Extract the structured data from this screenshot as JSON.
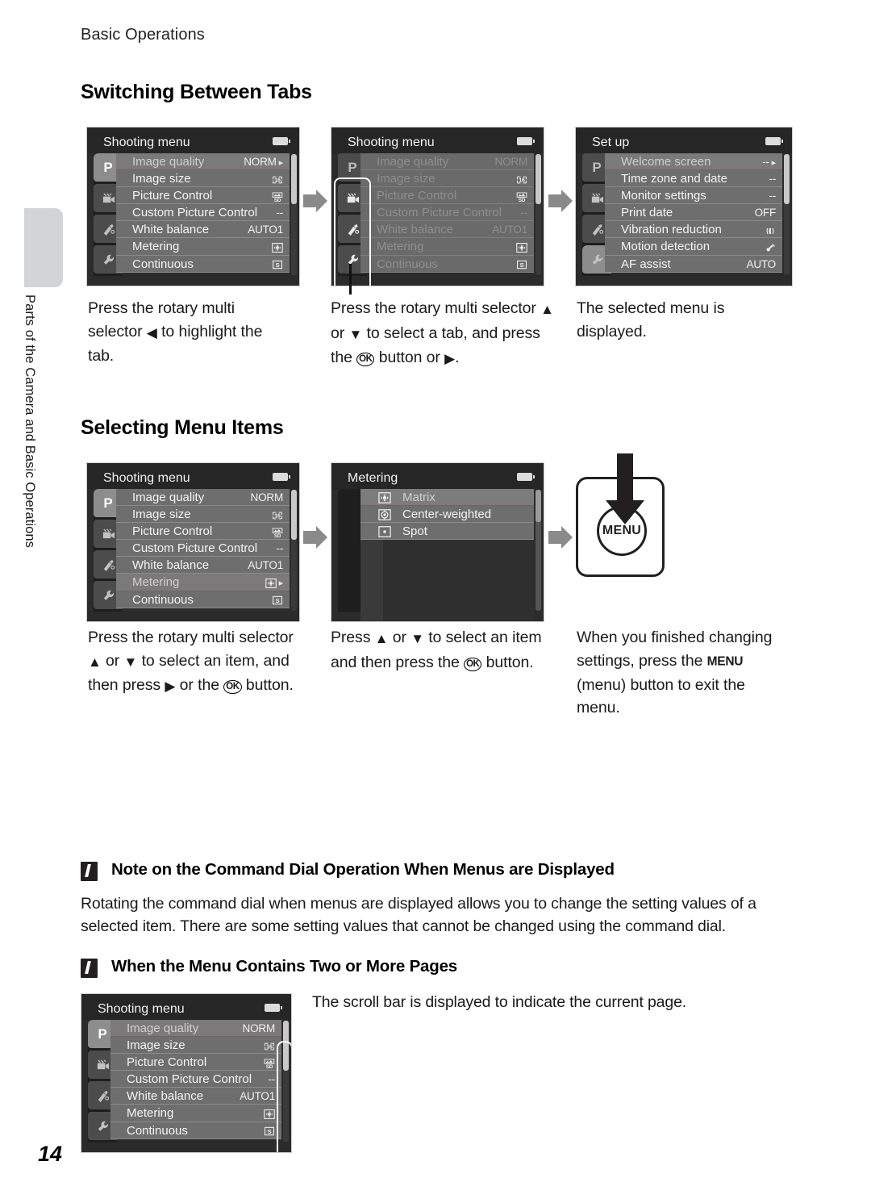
{
  "page": {
    "running_head": "Basic Operations",
    "number": "14",
    "side_tab_text": "Parts of the Camera and Basic Operations"
  },
  "sections": {
    "switching": {
      "title": "Switching Between Tabs"
    },
    "selecting": {
      "title": "Selecting Menu Items"
    }
  },
  "shooting_menu": {
    "title": "Shooting menu",
    "items": [
      {
        "label": "Image quality",
        "value": "NORM"
      },
      {
        "label": "Image size",
        "value": "16M"
      },
      {
        "label": "Picture Control",
        "value": "SD"
      },
      {
        "label": "Custom Picture Control",
        "value": "--"
      },
      {
        "label": "White balance",
        "value": "AUTO1"
      },
      {
        "label": "Metering",
        "value": "matrix-icon"
      },
      {
        "label": "Continuous",
        "value": "S"
      }
    ]
  },
  "setup_menu": {
    "title": "Set up",
    "items": [
      {
        "label": "Welcome screen",
        "value": "--"
      },
      {
        "label": "Time zone and date",
        "value": "--"
      },
      {
        "label": "Monitor settings",
        "value": "--"
      },
      {
        "label": "Print date",
        "value": "OFF"
      },
      {
        "label": "Vibration reduction",
        "value": "vr-icon"
      },
      {
        "label": "Motion detection",
        "value": "motion-icon"
      },
      {
        "label": "AF assist",
        "value": "AUTO"
      }
    ]
  },
  "metering_menu": {
    "title": "Metering",
    "items": [
      {
        "label": "Matrix",
        "icon": "matrix-icon"
      },
      {
        "label": "Center-weighted",
        "icon": "center-weighted-icon"
      },
      {
        "label": "Spot",
        "icon": "spot-icon"
      }
    ]
  },
  "tabs": [
    {
      "name": "shooting-mode-tab",
      "glyph": "P"
    },
    {
      "name": "movie-tab",
      "glyph": "movie-icon"
    },
    {
      "name": "effects-tab",
      "glyph": "effects-icon"
    },
    {
      "name": "setup-tab",
      "glyph": "wrench-icon"
    }
  ],
  "menu_button": {
    "label": "MENU"
  },
  "captions": {
    "switching": [
      {
        "id": "step1",
        "parts": [
          {
            "t": "text",
            "v": "Press the rotary multi selector "
          },
          {
            "t": "tri",
            "v": "◀"
          },
          {
            "t": "text",
            "v": " to highlight the tab."
          }
        ]
      },
      {
        "id": "step2",
        "parts": [
          {
            "t": "text",
            "v": "Press the rotary multi selector "
          },
          {
            "t": "tri",
            "v": "▲"
          },
          {
            "t": "text",
            "v": " or "
          },
          {
            "t": "tri",
            "v": "▼"
          },
          {
            "t": "text",
            "v": " to select a tab, and press the "
          },
          {
            "t": "ok",
            "v": "OK"
          },
          {
            "t": "text",
            "v": " button or "
          },
          {
            "t": "tri",
            "v": "▶"
          },
          {
            "t": "text",
            "v": "."
          }
        ]
      },
      {
        "id": "step3",
        "parts": [
          {
            "t": "text",
            "v": "The selected menu is displayed."
          }
        ]
      }
    ],
    "selecting": [
      {
        "id": "step1",
        "parts": [
          {
            "t": "text",
            "v": "Press the rotary multi selector "
          },
          {
            "t": "tri",
            "v": "▲"
          },
          {
            "t": "text",
            "v": " or "
          },
          {
            "t": "tri",
            "v": "▼"
          },
          {
            "t": "text",
            "v": " to select an item, and then press "
          },
          {
            "t": "tri",
            "v": "▶"
          },
          {
            "t": "text",
            "v": " or the "
          },
          {
            "t": "ok",
            "v": "OK"
          },
          {
            "t": "text",
            "v": " button."
          }
        ]
      },
      {
        "id": "step2",
        "parts": [
          {
            "t": "text",
            "v": "Press "
          },
          {
            "t": "tri",
            "v": "▲"
          },
          {
            "t": "text",
            "v": " or "
          },
          {
            "t": "tri",
            "v": "▼"
          },
          {
            "t": "text",
            "v": " to select an item and then press the "
          },
          {
            "t": "ok",
            "v": "OK"
          },
          {
            "t": "text",
            "v": " button."
          }
        ]
      },
      {
        "id": "step3",
        "parts": [
          {
            "t": "text",
            "v": "When you finished changing settings, press the "
          },
          {
            "t": "menu",
            "v": "MENU"
          },
          {
            "t": "text",
            "v": " (menu) button to exit the menu."
          }
        ]
      }
    ]
  },
  "notes": [
    {
      "id": "command-dial",
      "heading": "Note on the Command Dial Operation When Menus are Displayed",
      "body": "Rotating the command dial when menus are displayed allows you to change the setting values of a selected item. There are some setting values that cannot be changed using the command dial."
    },
    {
      "id": "two-or-more-pages",
      "heading": "When the Menu Contains Two or More Pages",
      "body": "The scroll bar is displayed to indicate the current page."
    }
  ]
}
